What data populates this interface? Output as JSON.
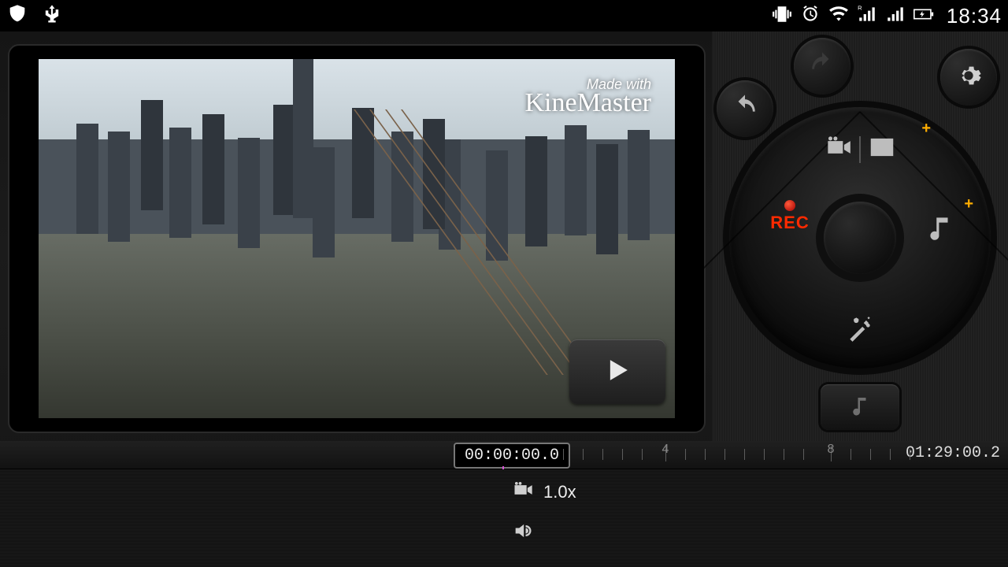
{
  "status": {
    "time": "18:34"
  },
  "preview": {
    "watermark_made": "Made with",
    "watermark_brand": "KineMaster"
  },
  "wheel": {
    "rec_label": "REC"
  },
  "timeline": {
    "playhead": "00:00:00.0",
    "end_time": "01:29:00.2",
    "marker_4": "4",
    "marker_8": "8",
    "speed_label": "1.0x"
  }
}
